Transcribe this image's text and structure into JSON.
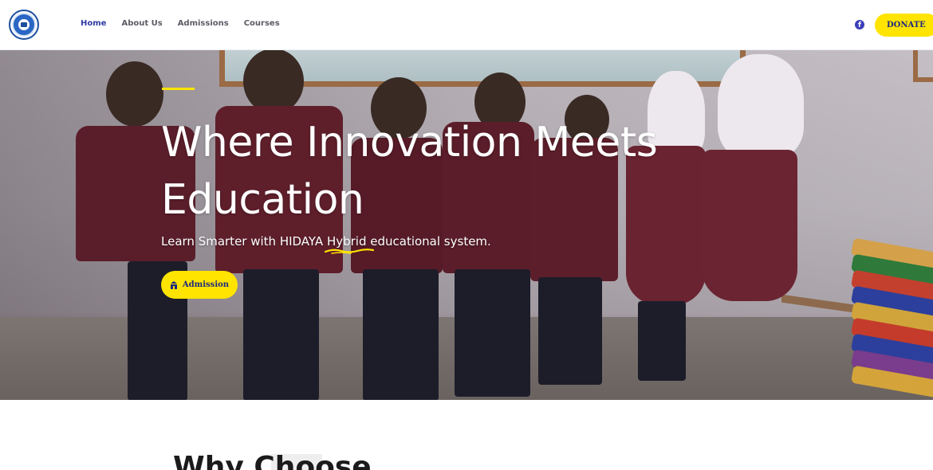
{
  "nav": {
    "items": [
      {
        "label": "Home",
        "active": true
      },
      {
        "label": "About Us",
        "active": false
      },
      {
        "label": "Admissions",
        "active": false
      },
      {
        "label": "Courses",
        "active": false
      }
    ]
  },
  "header": {
    "social_icon": "facebook-icon",
    "donate_label": "DONATE"
  },
  "hero": {
    "title": "Where Innovation Meets Education",
    "subtitle_before": "Learn Smarter with HIDAYA ",
    "subtitle_highlight": "Hybrid",
    "subtitle_after": " educational system.",
    "button_label": "Admission",
    "button_icon": "school-icon"
  },
  "section": {
    "title": "Why Choose"
  },
  "colors": {
    "accent": "#ffe400",
    "nav_active": "#2f3aa6",
    "nav_text": "#5b5b66",
    "button_text": "#1d2a80"
  }
}
